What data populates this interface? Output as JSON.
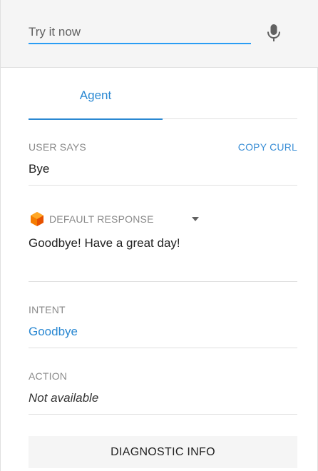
{
  "try_it": {
    "placeholder": "Try it now",
    "value": ""
  },
  "tabs": [
    {
      "label": "Agent",
      "active": true
    }
  ],
  "user_says": {
    "label": "USER SAYS",
    "value": "Bye",
    "copy_label": "COPY CURL"
  },
  "response": {
    "label": "DEFAULT RESPONSE",
    "value": "Goodbye! Have a great day!"
  },
  "intent": {
    "label": "INTENT",
    "value": "Goodbye"
  },
  "action": {
    "label": "ACTION",
    "value": "Not available"
  },
  "diagnostic": {
    "label": "DIAGNOSTIC INFO"
  },
  "colors": {
    "accent": "#2a88d2",
    "underline": "#2a9df4",
    "cube": "#f57c00",
    "muted": "#8a8a8a"
  }
}
